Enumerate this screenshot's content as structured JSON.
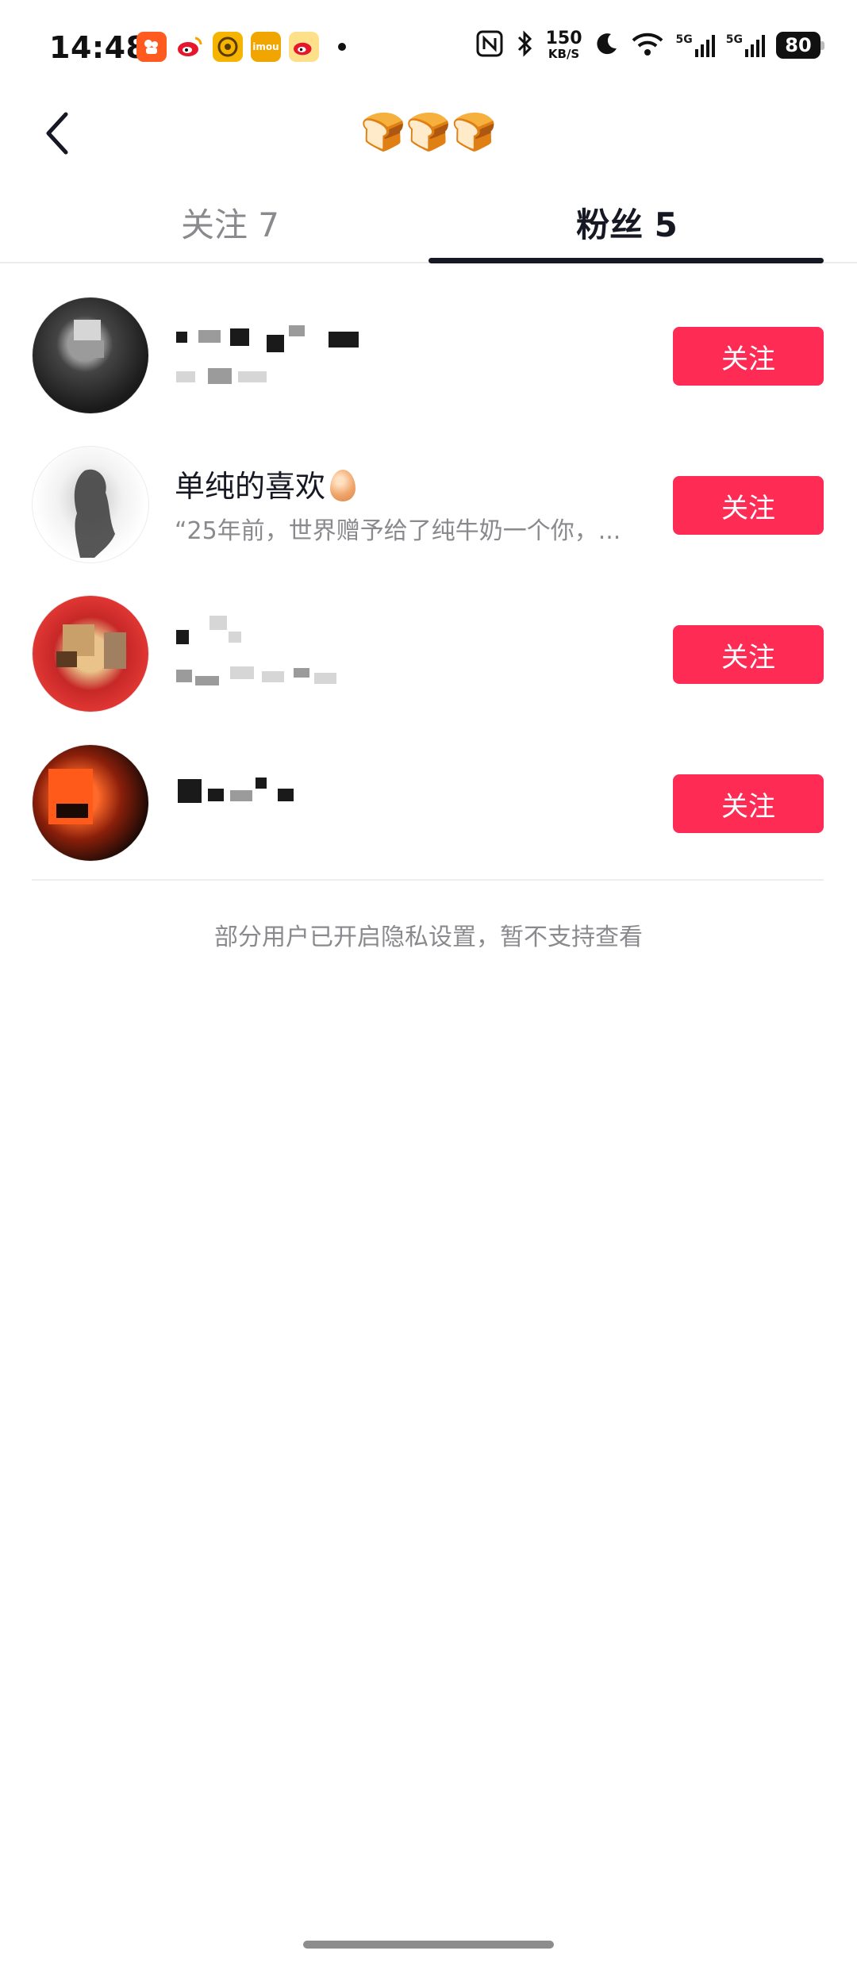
{
  "status_bar": {
    "time": "14:48",
    "net_speed_value": "150",
    "net_speed_unit": "KB/S",
    "signal_1": "5G",
    "signal_2": "5G",
    "battery": "80"
  },
  "header": {
    "title": "🍞🍞🍞"
  },
  "tabs": [
    {
      "label": "关注 7",
      "active": false
    },
    {
      "label": "粉丝 5",
      "active": true
    }
  ],
  "fans": [
    {
      "name": "",
      "bio": "",
      "button_label": "关注"
    },
    {
      "name": "单纯的喜欢",
      "bio": "“25年前，世界赠予给了纯牛奶一个你，...",
      "button_label": "关注"
    },
    {
      "name": "",
      "bio": "",
      "button_label": "关注"
    },
    {
      "name": "",
      "bio": "",
      "button_label": "关注"
    }
  ],
  "privacy_note": "部分用户已开启隐私设置，暂不支持查看",
  "colors": {
    "accent": "#fe2c55",
    "text_primary": "#161823",
    "text_secondary": "#8a8a8e"
  },
  "icons": {
    "back": "chevron-left-icon",
    "nfc": "nfc-icon",
    "bluetooth": "bluetooth-icon",
    "dnd": "moon-icon",
    "wifi": "wifi-icon",
    "signal": "signal-bars-icon",
    "battery": "battery-icon"
  }
}
